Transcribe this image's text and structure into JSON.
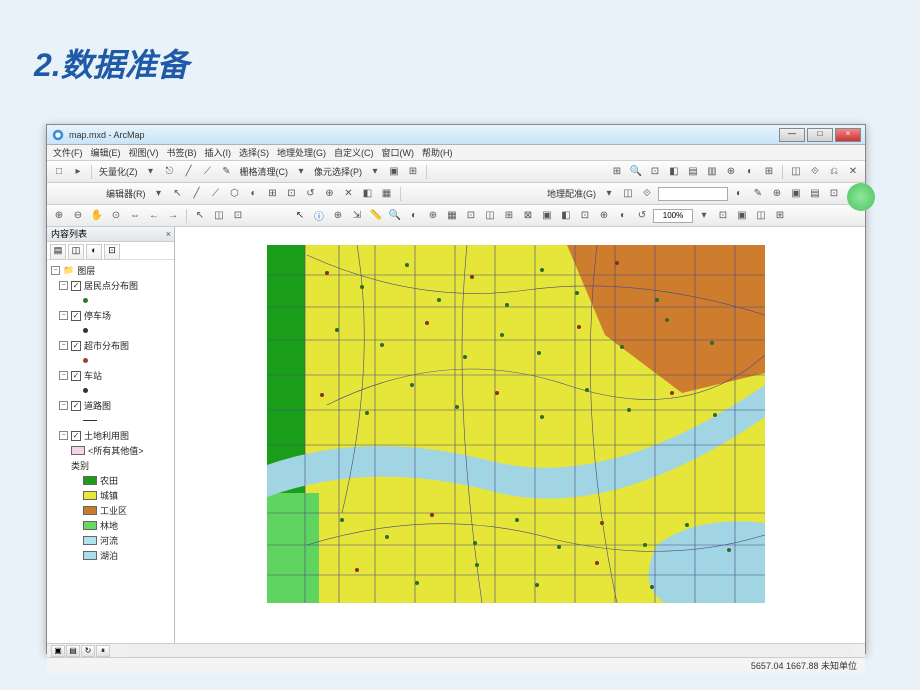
{
  "slide": {
    "title": "2.数据准备"
  },
  "window": {
    "title": "map.mxd - ArcMap",
    "min": "—",
    "max": "□",
    "close": "×"
  },
  "menu": {
    "items": [
      "文件(F)",
      "编辑(E)",
      "视图(V)",
      "书签(B)",
      "插入(I)",
      "选择(S)",
      "地理处理(G)",
      "自定义(C)",
      "窗口(W)",
      "帮助(H)"
    ]
  },
  "toolbar": {
    "row1": {
      "vectorize": "矢量化(Z)",
      "raster_clean": "栅格清理(C)",
      "cell_select": "像元选择(P)"
    },
    "row2": {
      "editor": "编辑器(R)",
      "georef": "地理配准(G)"
    },
    "row3": {
      "zoom": "100%"
    }
  },
  "toc": {
    "title": "内容列表",
    "root": "图层",
    "layers": [
      {
        "name": "居民点分布图",
        "expanded": true,
        "type": "point",
        "color": "#2a7a2a"
      },
      {
        "name": "停车场",
        "expanded": true,
        "type": "point",
        "color": "#333333"
      },
      {
        "name": "超市分布图",
        "expanded": true,
        "type": "point",
        "color": "#994433"
      },
      {
        "name": "车站",
        "expanded": true,
        "type": "point",
        "color": "#333333"
      },
      {
        "name": "道路图",
        "expanded": true,
        "type": "line"
      },
      {
        "name": "土地利用图",
        "expanded": true,
        "type": "poly",
        "all_other": "<所有其他值>",
        "cat_label": "类别",
        "classes": [
          {
            "label": "农田",
            "color": "#1a9e1a"
          },
          {
            "label": "城镇",
            "color": "#e8e83a"
          },
          {
            "label": "工业区",
            "color": "#c97a2a"
          },
          {
            "label": "林地",
            "color": "#66d966"
          },
          {
            "label": "河流",
            "color": "#b0e4ec"
          },
          {
            "label": "湖泊",
            "color": "#a8ddea"
          }
        ]
      }
    ]
  },
  "status": {
    "coords": "5657.04  1667.88 未知单位"
  },
  "map_colors": {
    "urban": "#e5e53a",
    "farm": "#1a9e1a",
    "forest": "#60d460",
    "industrial": "#ce7c2e",
    "river": "#a1d5e4",
    "lake": "#a1d5e4",
    "road": "#4a4a80",
    "point1": "#2b6b2b",
    "point2": "#8b3020"
  }
}
